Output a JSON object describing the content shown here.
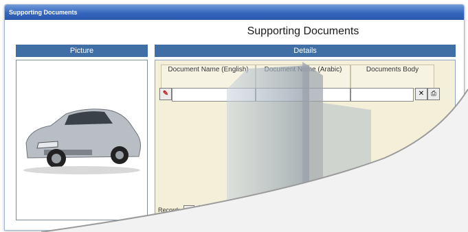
{
  "window": {
    "title": "Supporting Documents"
  },
  "form": {
    "heading": "Supporting Documents"
  },
  "picture_panel": {
    "header": "Picture",
    "image_name": "car-photo"
  },
  "details_panel": {
    "header": "Details",
    "columns": [
      "Document Name (English)",
      "Document Name (Arabic)",
      "Documents Body"
    ],
    "row": {
      "english_value": "",
      "arabic_value": "",
      "body_value": ""
    }
  },
  "record_nav": {
    "label": "Record:",
    "first_glyph": "|◀",
    "prev_glyph": "◀"
  },
  "colors": {
    "title_bar": "#3566bd",
    "panel_header": "#3f6fa5",
    "details_bg": "#f4efd8"
  }
}
